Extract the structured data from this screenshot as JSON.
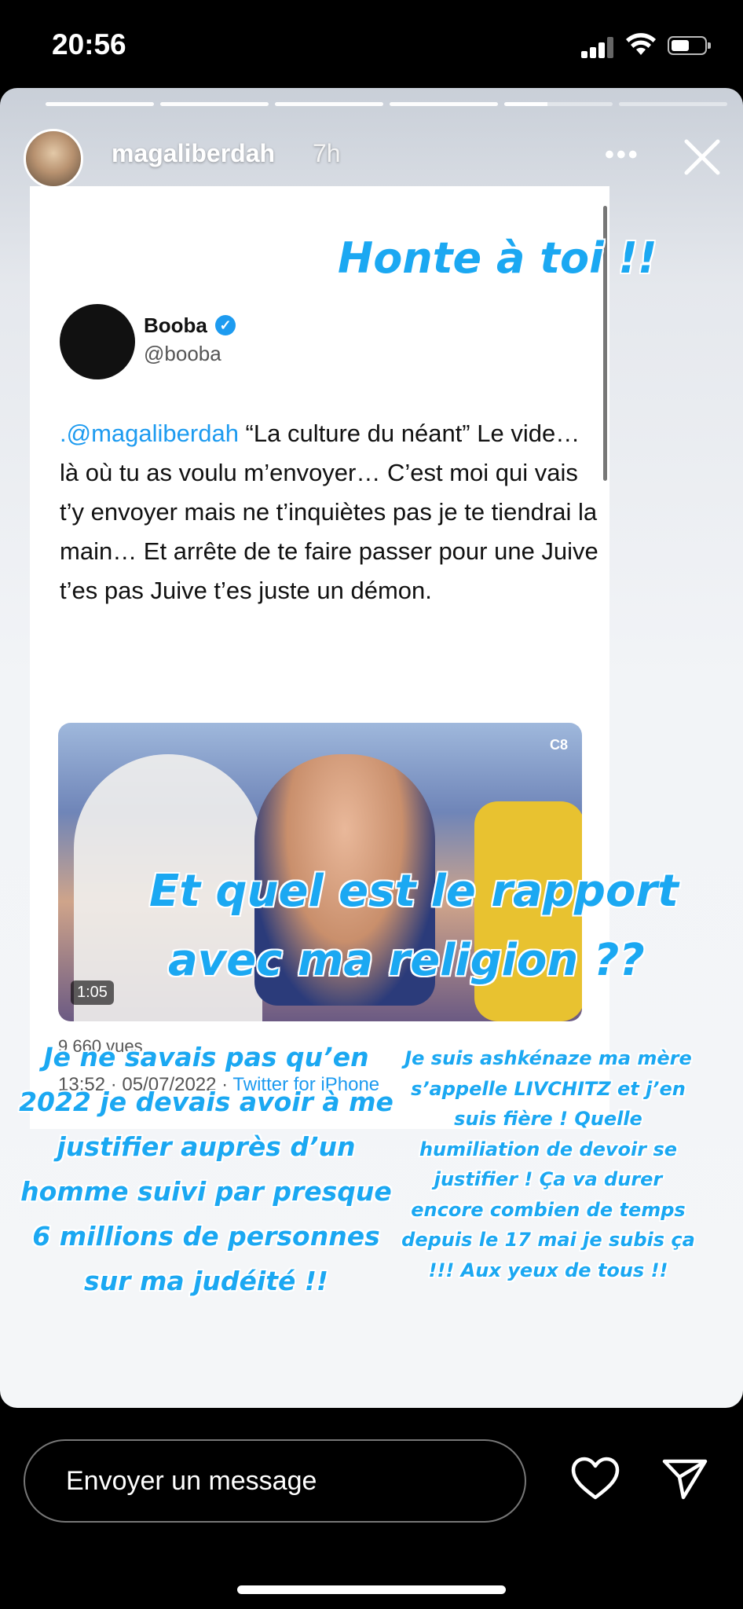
{
  "status_bar": {
    "time": "20:56"
  },
  "story": {
    "username": "magaliberdah",
    "age": "7h",
    "more_label": "•••"
  },
  "tweet": {
    "author_name": "Booba",
    "author_handle": "@booba",
    "mention": ".@magaliberdah",
    "text_body": " “La culture du néant” Le vide… là où tu as voulu m’envoyer… C’est moi qui vais t’y envoyer mais ne t’inquiètes pas je te tiendrai la main… Et arrête de te faire passer pour une Juive t’es pas Juive t’es juste un démon.",
    "video_duration": "1:05",
    "channel_logo": "C8",
    "views": "9 660 vues",
    "timestamp": "13:52 · 05/07/2022 · ",
    "source": "Twitter for iPhone"
  },
  "overlays": {
    "honte": "Honte à toi !!",
    "rapport_line1": "Et quel est le rapport",
    "rapport_line2": "avec ma religion ??",
    "left_text": "Je ne savais pas qu’en 2022 je devais avoir à me justifier auprès d’un homme suivi par presque 6 millions de personnes sur ma judéité !!",
    "right_text": "Je suis ashkénaze ma mère s’appelle LIVCHITZ et j’en suis fière ! Quelle humiliation de devoir se justifier ! Ça va durer encore combien de temps depuis le 17 mai je subis ça !!! Aux yeux de tous !!"
  },
  "composer": {
    "placeholder": "Envoyer un message"
  },
  "icons": [
    "signal-icon",
    "wifi-icon",
    "battery-icon",
    "close-icon",
    "heart-icon",
    "send-icon",
    "verified-icon"
  ],
  "colors": {
    "overlay_text": "#1ba8f2",
    "link": "#1d9bf0"
  }
}
